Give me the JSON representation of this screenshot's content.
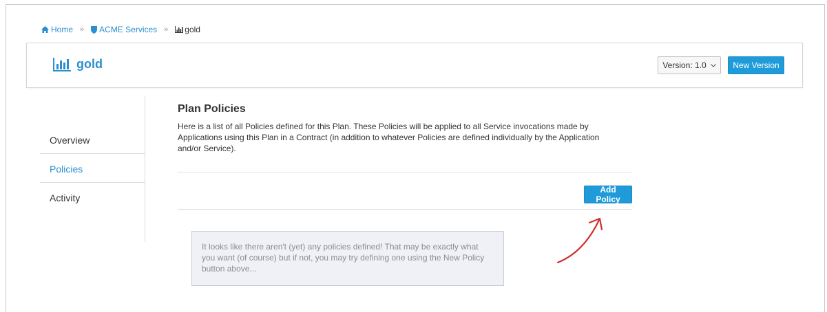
{
  "breadcrumb": {
    "home": "Home",
    "service": "ACME Services",
    "current": "gold",
    "separator": "»"
  },
  "header": {
    "title": "gold",
    "version_select": "Version: 1.0",
    "new_version_label": "New Version"
  },
  "sidebar": {
    "items": [
      {
        "label": "Overview"
      },
      {
        "label": "Policies"
      },
      {
        "label": "Activity"
      }
    ]
  },
  "main": {
    "title": "Plan Policies",
    "description": "Here is a list of all Policies defined for this Plan. These Policies will be applied to all Service invocations made by Applications using this Plan in a Contract (in addition to whatever Policies are defined individually by the Application and/or Service).",
    "add_policy_label": "Add Policy",
    "empty_message": "It looks like there aren't (yet) any policies defined! That may be exactly what you want (of course) but if not, you may try defining one using the New Policy button above..."
  },
  "colors": {
    "accent": "#2a8fd0",
    "button": "#1f9bd9",
    "annotation_arrow": "#d0312d"
  }
}
